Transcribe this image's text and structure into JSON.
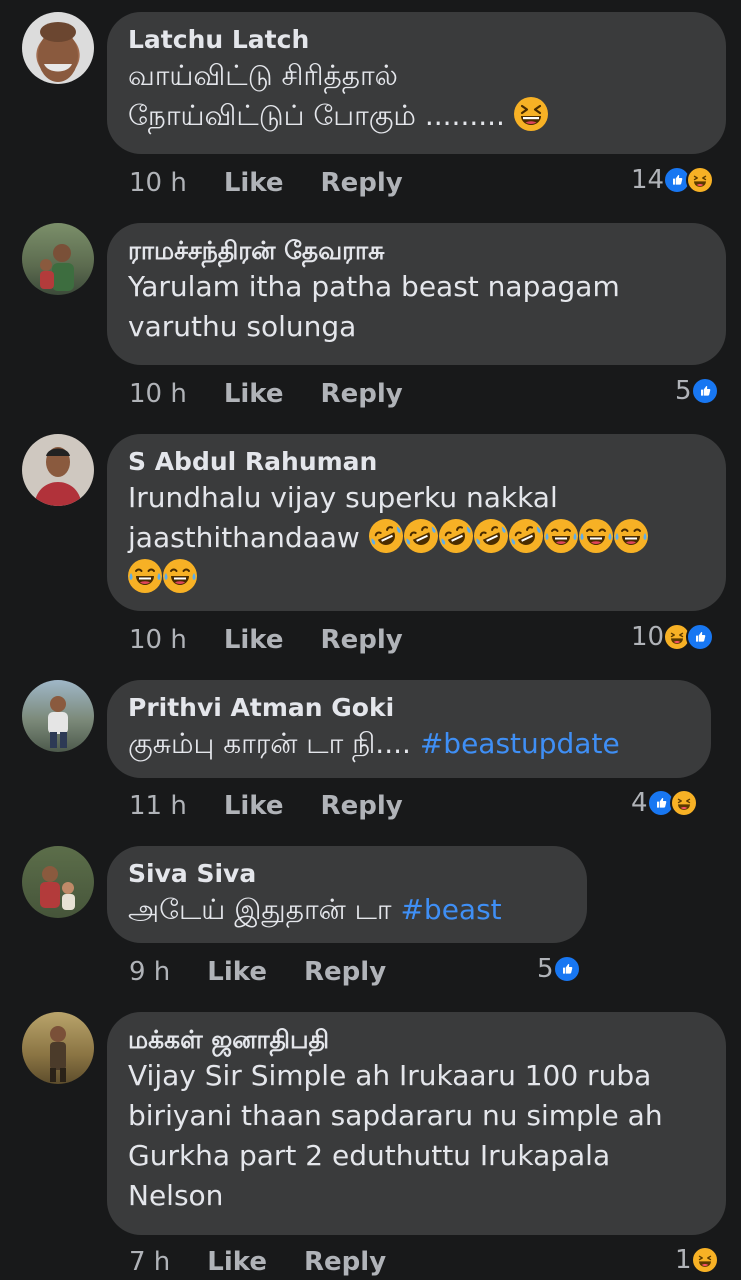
{
  "comments": [
    {
      "author": "Latchu Latch",
      "text_lines": [
        "வாய்விட்டு சிரித்தால்",
        "நோய்விட்டுப் போகும் ........."
      ],
      "time": "10 h",
      "like_label": "Like",
      "reply_label": "Reply",
      "reaction_count": "14",
      "reactions": [
        "like-icon",
        "haha-icon"
      ],
      "trailing_emoji": [
        "grinning-squint-emoji"
      ]
    },
    {
      "author": "ராமச்சந்திரன் தேவராசு",
      "text_lines": [
        "Yarulam itha patha beast napagam",
        "varuthu solunga"
      ],
      "time": "10 h",
      "like_label": "Like",
      "reply_label": "Reply",
      "reaction_count": "5",
      "reactions": [
        "like-icon"
      ]
    },
    {
      "author": "S Abdul Rahuman",
      "text_lines": [
        "Irundhalu vijay superku nakkal",
        "jaasthithandaaw"
      ],
      "time": "10 h",
      "like_label": "Like",
      "reply_label": "Reply",
      "reaction_count": "10",
      "reactions": [
        "haha-icon",
        "like-icon"
      ],
      "trailing_emoji": [
        "rolling-laughing-emoji",
        "rolling-laughing-emoji",
        "rolling-laughing-emoji",
        "rolling-laughing-emoji",
        "rolling-laughing-emoji",
        "tears-of-joy-emoji",
        "tears-of-joy-emoji",
        "tears-of-joy-emoji",
        "tears-of-joy-emoji",
        "tears-of-joy-emoji"
      ]
    },
    {
      "author": "Prithvi Atman Goki",
      "text": "குசும்பு காரன் டா நி....",
      "hashtag": "#beastupdate",
      "time": "11 h",
      "like_label": "Like",
      "reply_label": "Reply",
      "reaction_count": "4",
      "reactions": [
        "like-icon",
        "haha-icon"
      ]
    },
    {
      "author": "Siva Siva",
      "text": "அடேய் இதுதான் டா",
      "hashtag": "#beast",
      "time": "9 h",
      "like_label": "Like",
      "reply_label": "Reply",
      "reaction_count": "5",
      "reactions": [
        "like-icon"
      ]
    },
    {
      "author": "மக்கள் ஜனாதிபதி",
      "text_lines": [
        "Vijay Sir Simple ah Irukaaru 100 ruba",
        "biriyani thaan sapdararu nu simple ah",
        "Gurkha part 2 eduthuttu Irukapala",
        "Nelson"
      ],
      "time": "7 h",
      "like_label": "Like",
      "reply_label": "Reply",
      "reaction_count": "1",
      "reactions": [
        "haha-icon"
      ]
    }
  ],
  "colors": {
    "background": "#18191a",
    "bubble": "#3a3b3c",
    "hashtag": "#3f8ff5",
    "like_blue": "#1877f2",
    "haha_yellow": "#f7b125",
    "meta_gray": "#b0b3b8"
  }
}
